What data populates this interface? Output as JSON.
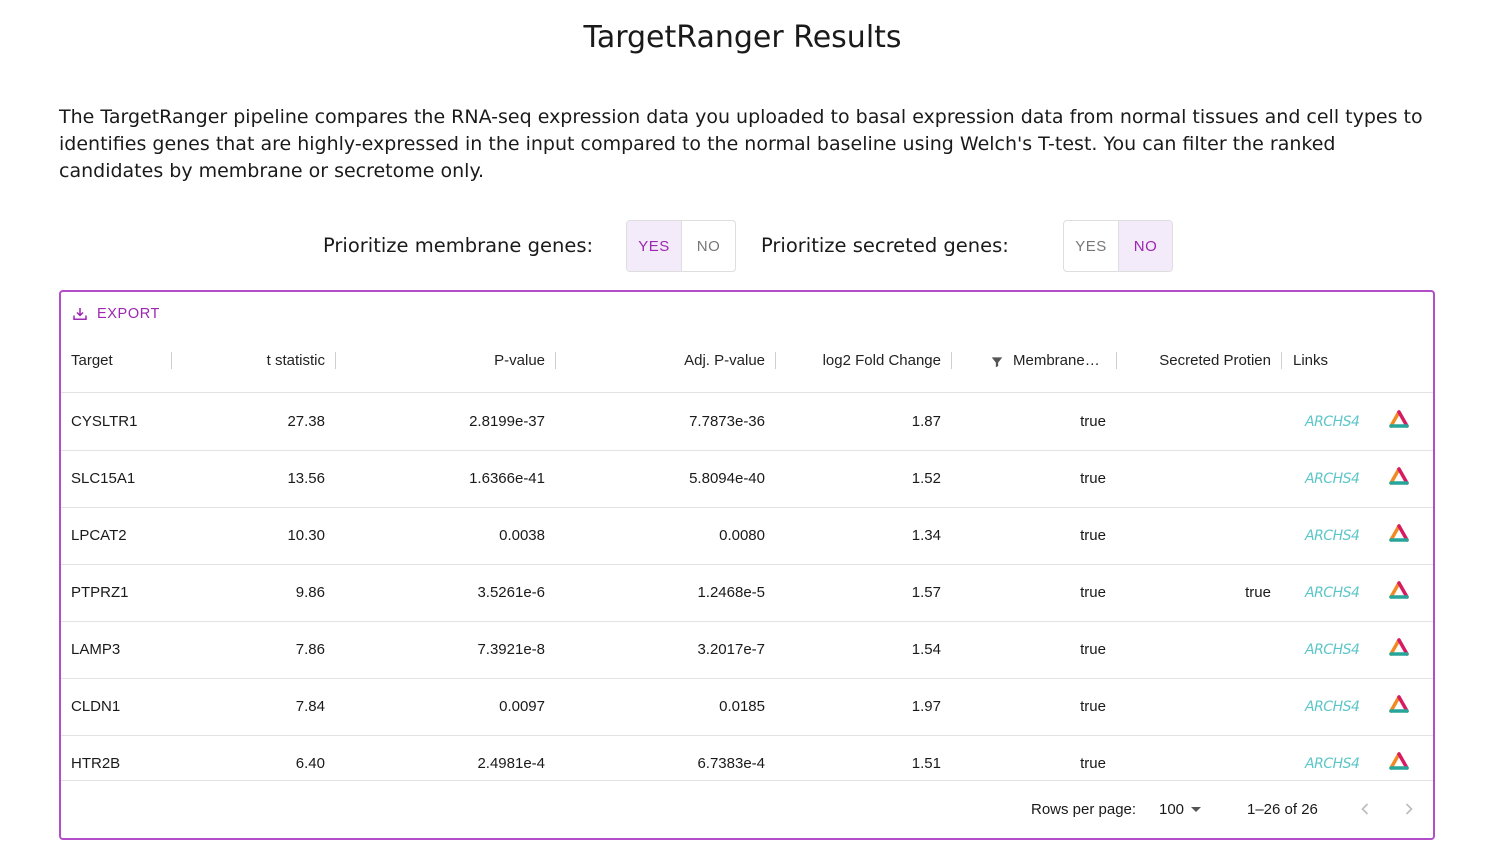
{
  "page": {
    "title": "TargetRanger Results",
    "description": "The TargetRanger pipeline compares the RNA-seq expression data you uploaded to basal expression data from normal tissues and cell types to identifies genes that are highly-expressed in the input compared to the normal baseline using Welch's T-test. You can filter the ranked candidates by membrane or secretome only."
  },
  "toggles": {
    "membrane": {
      "label": "Prioritize membrane genes:",
      "yes": "YES",
      "no": "NO",
      "selected": "YES"
    },
    "secreted": {
      "label": "Prioritize secreted genes:",
      "yes": "YES",
      "no": "NO",
      "selected": "NO"
    }
  },
  "grid": {
    "export_label": "EXPORT",
    "columns": [
      "Target",
      "t statistic",
      "P-value",
      "Adj. P-value",
      "log2 Fold Change",
      "Membrane…",
      "Secreted Protien",
      "Links"
    ],
    "rows": [
      {
        "target": "CYSLTR1",
        "t": "27.38",
        "p": "2.8199e-37",
        "adj": "7.7873e-36",
        "fc": "1.87",
        "membrane": "true",
        "secreted": ""
      },
      {
        "target": "SLC15A1",
        "t": "13.56",
        "p": "1.6366e-41",
        "adj": "5.8094e-40",
        "fc": "1.52",
        "membrane": "true",
        "secreted": ""
      },
      {
        "target": "LPCAT2",
        "t": "10.30",
        "p": "0.0038",
        "adj": "0.0080",
        "fc": "1.34",
        "membrane": "true",
        "secreted": ""
      },
      {
        "target": "PTPRZ1",
        "t": "9.86",
        "p": "3.5261e-6",
        "adj": "1.2468e-5",
        "fc": "1.57",
        "membrane": "true",
        "secreted": "true"
      },
      {
        "target": "LAMP3",
        "t": "7.86",
        "p": "7.3921e-8",
        "adj": "3.2017e-7",
        "fc": "1.54",
        "membrane": "true",
        "secreted": ""
      },
      {
        "target": "CLDN1",
        "t": "7.84",
        "p": "0.0097",
        "adj": "0.0185",
        "fc": "1.97",
        "membrane": "true",
        "secreted": ""
      },
      {
        "target": "HTR2B",
        "t": "6.40",
        "p": "2.4981e-4",
        "adj": "6.7383e-4",
        "fc": "1.51",
        "membrane": "true",
        "secreted": ""
      }
    ],
    "link_label": "ARCHS4",
    "footer": {
      "rows_per_page_label": "Rows per page:",
      "rows_per_page": "100",
      "range": "1–26 of 26"
    }
  },
  "colors": {
    "accent": "#9c27b0",
    "border": "#b14ec8",
    "archs4": "#5cc6c8"
  }
}
